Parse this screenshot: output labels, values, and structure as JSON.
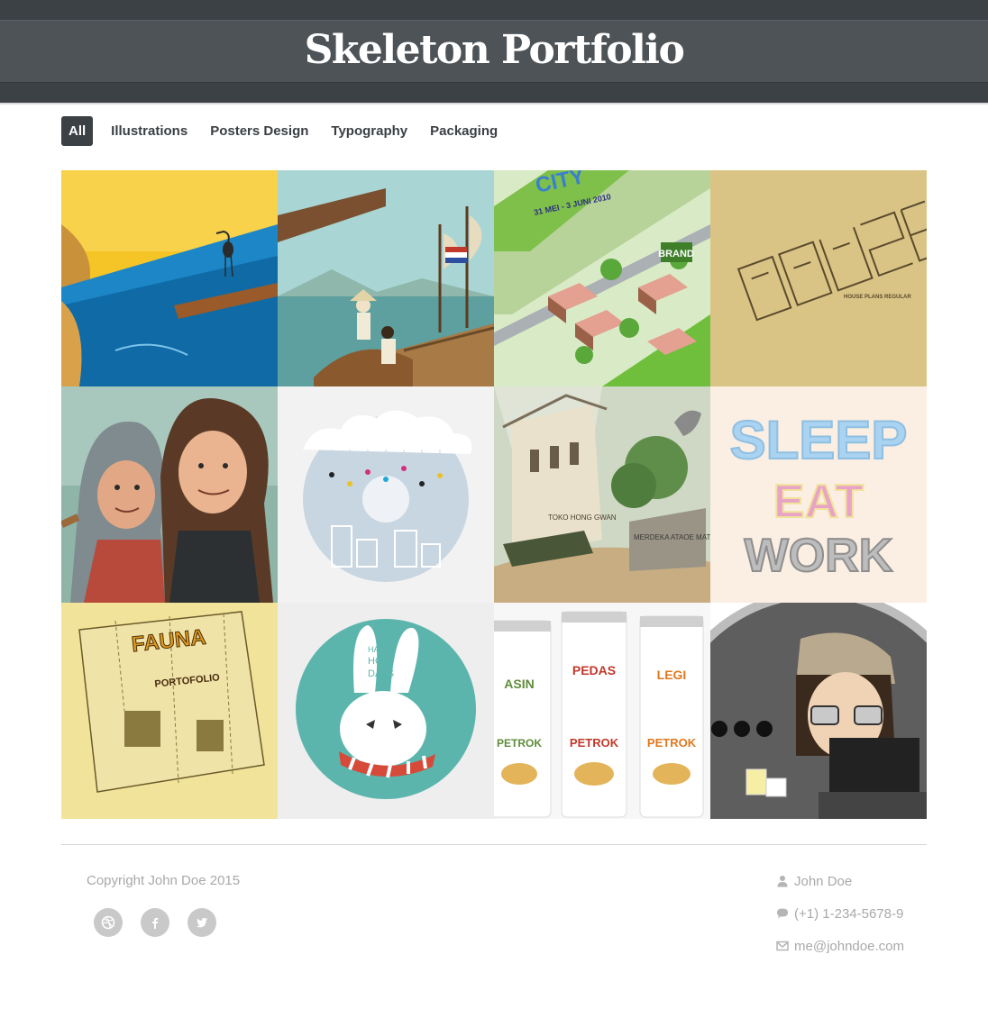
{
  "header": {
    "title": "Skeleton Portfolio"
  },
  "filters": [
    {
      "label": "All",
      "active": true
    },
    {
      "label": "Illustrations",
      "active": false
    },
    {
      "label": "Posters Design",
      "active": false
    },
    {
      "label": "Typography",
      "active": false
    },
    {
      "label": "Packaging",
      "active": false
    }
  ],
  "gallery": {
    "tiles": [
      {
        "name": "tile-heron-sea",
        "category": "Illustrations"
      },
      {
        "name": "tile-sailing-ship",
        "category": "Illustrations"
      },
      {
        "name": "tile-city-poster",
        "category": "Posters Design",
        "text": "CITY",
        "subtext": "31 MEI - 3 JUNI 2010",
        "badge": "BRAND"
      },
      {
        "name": "tile-house-typography",
        "category": "Typography",
        "text": "HOUSE PLANS REGULAR"
      },
      {
        "name": "tile-two-characters",
        "category": "Illustrations"
      },
      {
        "name": "tile-donut-poster",
        "category": "Posters Design"
      },
      {
        "name": "tile-toko-street",
        "category": "Illustrations",
        "text": "TOKO HONG GWAN",
        "subtext": "MERDEKA ATAOE MATI"
      },
      {
        "name": "tile-sleep-eat-work",
        "category": "Typography",
        "lines": [
          "SLEEP",
          "EAT",
          "WORK"
        ]
      },
      {
        "name": "tile-fauna-packaging",
        "category": "Packaging",
        "text": "FAUNA",
        "subtext": "PORTOFOLIO"
      },
      {
        "name": "tile-happy-holidays",
        "category": "Illustrations",
        "lines": [
          "HAPPY",
          "HOLI",
          "DAYS"
        ]
      },
      {
        "name": "tile-petrok-cans",
        "category": "Packaging",
        "cans": [
          "ASIN",
          "PEDAS",
          "LEGI"
        ],
        "brand": "PETROK"
      },
      {
        "name": "tile-desk-character",
        "category": "Illustrations"
      }
    ]
  },
  "footer": {
    "copyright": "Copyright John Doe 2015",
    "socials": [
      {
        "icon": "dribbble-icon"
      },
      {
        "icon": "facebook-icon"
      },
      {
        "icon": "twitter-icon"
      }
    ],
    "contact": {
      "name": "John Doe",
      "phone": "(+1) 1-234-5678-9",
      "email": "me@johndoe.com"
    }
  },
  "colors": {
    "header_dark": "#3c4146",
    "title_band": "#4e5358",
    "footer_text": "#a9a9a9",
    "social_bg": "#c9c9c9"
  }
}
